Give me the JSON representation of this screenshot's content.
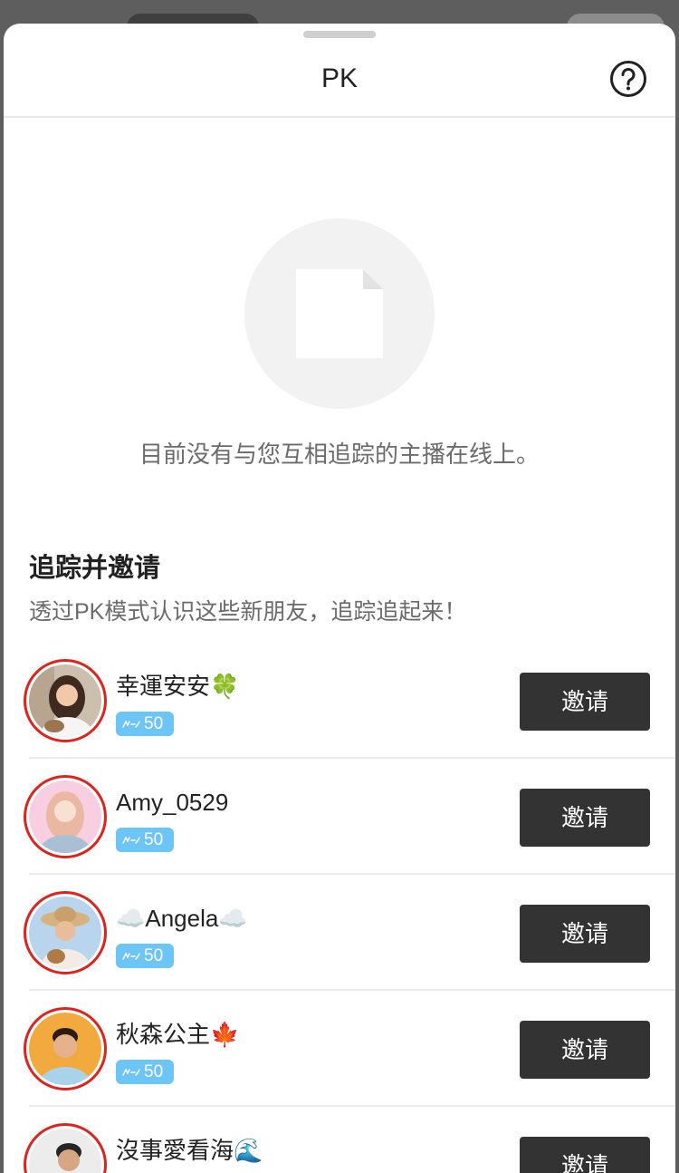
{
  "header": {
    "title": "PK",
    "help_icon": "question-circle-icon",
    "grabber": "drag-handle"
  },
  "empty_state": {
    "icon": "blank-document-icon",
    "message": "目前没有与您互相追踪的主播在线上。"
  },
  "invite_section": {
    "title": "追踪并邀请",
    "subtitle": "透过PK模式认识这些新朋友，追踪追起来！"
  },
  "streamers": [
    {
      "name": "幸運安安🍀",
      "level": "50",
      "invite_label": "邀请"
    },
    {
      "name": "Amy_0529",
      "level": "50",
      "invite_label": "邀请"
    },
    {
      "name": "☁️Angela☁️",
      "level": "50",
      "invite_label": "邀请"
    },
    {
      "name": "秋森公主🍁",
      "level": "50",
      "invite_label": "邀请"
    },
    {
      "name": "沒事愛看海🌊",
      "invite_label": "邀请"
    }
  ],
  "colors": {
    "accent_ring": "#e0221c",
    "badge": "#6cc5f7",
    "invite_button": "#333333",
    "empty_icon_bg": "#f2f2f2"
  }
}
